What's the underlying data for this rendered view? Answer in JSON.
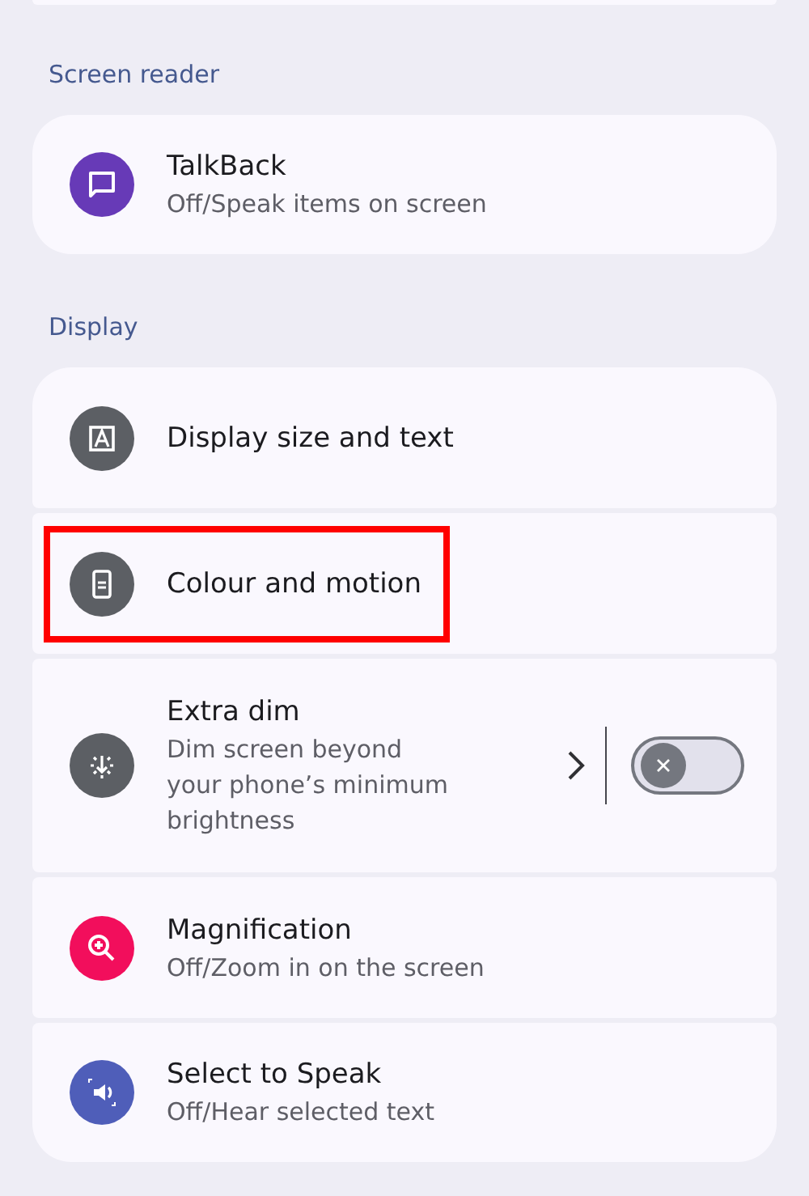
{
  "sections": [
    {
      "header": "Screen reader",
      "items": [
        {
          "kind": "link",
          "title": "TalkBack",
          "subtitle": "Off/Speak items on screen",
          "color": "#673ab7",
          "highlighted": false
        }
      ]
    },
    {
      "header": "Display",
      "items": [
        {
          "kind": "link",
          "title": "Display size and text",
          "color": "#5c5f64",
          "highlighted": false
        },
        {
          "kind": "link",
          "title": "Colour and motion",
          "color": "#5c5f64",
          "highlighted": true
        },
        {
          "kind": "toggle",
          "title": "Extra dim",
          "subtitle": "Dim screen beyond your phone’s minimum brightness",
          "color": "#5c5f64",
          "highlighted": false,
          "on": false
        },
        {
          "kind": "link",
          "title": "Magnification",
          "subtitle": "Off/Zoom in on the screen",
          "color": "#f20e5c",
          "highlighted": false
        },
        {
          "kind": "link",
          "title": "Select to Speak",
          "subtitle": "Off/Hear selected text",
          "color": "#4f5eb9",
          "highlighted": false
        }
      ]
    }
  ]
}
